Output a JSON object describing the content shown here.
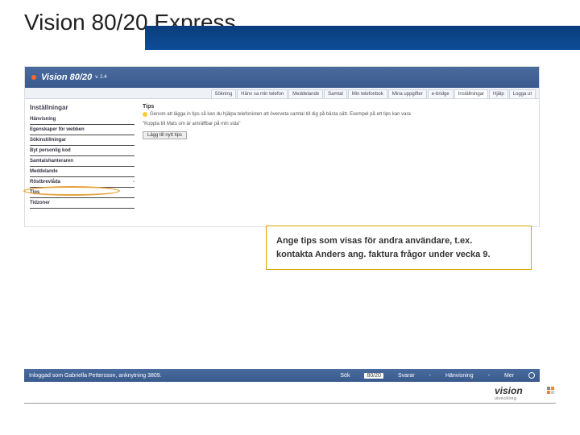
{
  "slide": {
    "title": "Vision 80/20 Express"
  },
  "app": {
    "name": "Vision 80/20",
    "version": "v. 2.4",
    "tabs": [
      "Sökning",
      "Hänv sa min telefon",
      "Meddelande",
      "Samtal",
      "Min telefonbok",
      "Mina uppgifter",
      "e-bridge",
      "Inställningar",
      "Hjälp",
      "Logga ut"
    ],
    "active_tab_index": 7,
    "sidebar_title": "Inställningar",
    "sidebar_items": [
      "Hänvisning",
      "Egenskaper för webben",
      "Sökinstillningar",
      "Byt personlig kod",
      "Samtalshanteraren",
      "Meddelande",
      "Röstbrevlåda",
      "Tips",
      "Tidzoner"
    ],
    "content_title": "Tips",
    "tip_text": "Genom att lägga in tips så kan du hjälpa telefonisten att överveta samtal till dig på bästa sätt. Exempel på ett tips kan vara",
    "tip_quote": "\"Koppla till Mats om är anträffbar på min sida\"",
    "add_button": "Lägg till nytt tips"
  },
  "callout": {
    "line1": "Ange tips som visas för andra användare, t.ex.",
    "line2": "kontakta Anders ang. faktura frågor under vecka 9."
  },
  "status": {
    "user": "Inloggad som Gabriella Pettersson, anknytning 3809.",
    "sok_label": "Sök",
    "sok_value": "80/20",
    "svarar_label": "Svarar",
    "svarar_value": "-",
    "hanviser_label": "Hänvisning",
    "hanviser_value": "-",
    "mer_label": "Mer"
  },
  "footer_logo": {
    "text": "vision",
    "sub": "utveckling"
  },
  "colors": {
    "sq1": "#888",
    "sq2": "#e68a2e",
    "sq3": "#e68a2e",
    "sq4": "#ccc"
  }
}
